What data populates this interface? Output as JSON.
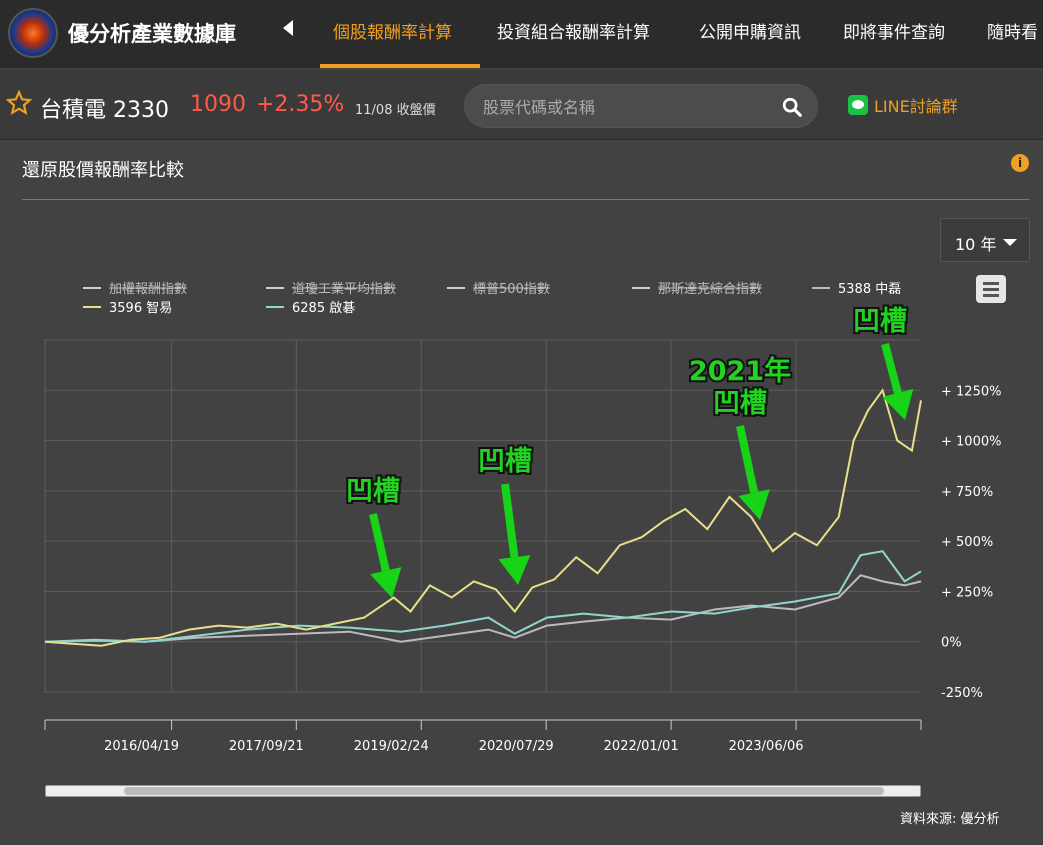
{
  "brand": "優分析產業數據庫",
  "nav": {
    "tabs": [
      "個股報酬率計算",
      "投資組合報酬率計算",
      "公開申購資訊",
      "即將事件查詢",
      "隨時看"
    ],
    "active_index": 0,
    "accent": "#f0a020"
  },
  "stock": {
    "name": "台積電 2330",
    "price": "1090",
    "change": "+2.35%",
    "date_label": "11/08 收盤價",
    "up_color": "#ff5a4a"
  },
  "search": {
    "placeholder": "股票代碼或名稱"
  },
  "line_group": "LINE討論群",
  "panel": {
    "title": "還原股價報酬率比較",
    "range": "10 年",
    "source": "資料來源: 優分析"
  },
  "chart_data": {
    "type": "line",
    "title": "",
    "y_ticks": [
      "+ 1250%",
      "+ 1000%",
      "+ 750%",
      "+ 500%",
      "+ 250%",
      "0%",
      "-250%"
    ],
    "y_tick_values": [
      1250,
      1000,
      750,
      500,
      250,
      0,
      -250
    ],
    "ylim": [
      -250,
      1500
    ],
    "x_ticks": [
      "2016/04/19",
      "2017/09/21",
      "2019/02/24",
      "2020/07/29",
      "2022/01/01",
      "2023/06/06"
    ],
    "xlim": [
      "2014/11/08",
      "2024/11/08"
    ],
    "grid": true,
    "legend": [
      {
        "name": "加權報酬指數",
        "hidden": true
      },
      {
        "name": "道瓊工業平均指數",
        "hidden": true
      },
      {
        "name": "標普500指數",
        "hidden": true
      },
      {
        "name": "那斯達克綜合指數",
        "hidden": true
      },
      {
        "name": "5388 中磊",
        "hidden": false,
        "color": "#bbbbbb"
      },
      {
        "name": "3596 智易",
        "hidden": false,
        "color": "#e8df8a"
      },
      {
        "name": "6285 啟碁",
        "hidden": false,
        "color": "#8ed6cf"
      }
    ],
    "series": [
      {
        "name": "3596 智易",
        "color": "#e8df8a",
        "x": [
          "2014/11/08",
          "2015/03/01",
          "2015/07/01",
          "2015/11/01",
          "2016/03/01",
          "2016/07/01",
          "2016/11/01",
          "2017/03/01",
          "2017/07/01",
          "2017/11/01",
          "2018/03/01",
          "2018/07/01",
          "2018/11/01",
          "2019/01/10",
          "2019/04/01",
          "2019/07/01",
          "2019/10/01",
          "2020/01/01",
          "2020/03/20",
          "2020/06/01",
          "2020/09/01",
          "2020/12/01",
          "2021/03/01",
          "2021/06/01",
          "2021/09/01",
          "2021/12/01",
          "2022/03/01",
          "2022/06/01",
          "2022/09/01",
          "2022/12/01",
          "2023/03/01",
          "2023/06/01",
          "2023/09/01",
          "2023/12/01",
          "2024/02/01",
          "2024/04/01",
          "2024/06/01",
          "2024/08/01",
          "2024/10/01",
          "2024/11/08"
        ],
        "values": [
          0,
          -10,
          -20,
          10,
          20,
          60,
          80,
          70,
          90,
          60,
          90,
          120,
          220,
          150,
          280,
          220,
          300,
          260,
          150,
          270,
          310,
          420,
          340,
          480,
          520,
          600,
          660,
          560,
          720,
          620,
          450,
          540,
          480,
          620,
          1000,
          1150,
          1250,
          1000,
          950,
          1200
        ]
      },
      {
        "name": "6285 啟碁",
        "color": "#8ed6cf",
        "x": [
          "2014/11/08",
          "2015/06/01",
          "2016/01/01",
          "2016/08/01",
          "2017/03/01",
          "2017/10/01",
          "2018/05/01",
          "2018/12/01",
          "2019/06/01",
          "2019/12/01",
          "2020/03/20",
          "2020/08/01",
          "2021/01/01",
          "2021/07/01",
          "2022/01/01",
          "2022/07/01",
          "2022/12/01",
          "2023/06/01",
          "2023/12/01",
          "2024/03/01",
          "2024/06/01",
          "2024/09/01",
          "2024/11/08"
        ],
        "values": [
          0,
          10,
          0,
          30,
          60,
          80,
          70,
          50,
          80,
          120,
          40,
          120,
          140,
          120,
          150,
          140,
          170,
          200,
          240,
          430,
          450,
          300,
          350
        ]
      },
      {
        "name": "5388 中磊",
        "color": "#bbbbbb",
        "x": [
          "2014/11/08",
          "2015/06/01",
          "2016/01/01",
          "2016/08/01",
          "2017/03/01",
          "2017/10/01",
          "2018/05/01",
          "2018/12/01",
          "2019/06/01",
          "2019/12/01",
          "2020/03/20",
          "2020/08/01",
          "2021/01/01",
          "2021/07/01",
          "2022/01/01",
          "2022/07/01",
          "2022/12/01",
          "2023/06/01",
          "2023/12/01",
          "2024/03/01",
          "2024/06/01",
          "2024/09/01",
          "2024/11/08"
        ],
        "values": [
          0,
          5,
          0,
          20,
          30,
          40,
          50,
          0,
          30,
          60,
          20,
          80,
          100,
          120,
          110,
          160,
          180,
          160,
          220,
          330,
          300,
          280,
          300
        ]
      }
    ],
    "annotations": [
      {
        "text": "凹槽",
        "date": "2019/01/10"
      },
      {
        "text": "凹槽",
        "date": "2020/03/20"
      },
      {
        "text": "2021年\n凹槽",
        "date": "2023/03/01"
      },
      {
        "text": "凹槽",
        "date": "2024/10/01"
      }
    ]
  }
}
